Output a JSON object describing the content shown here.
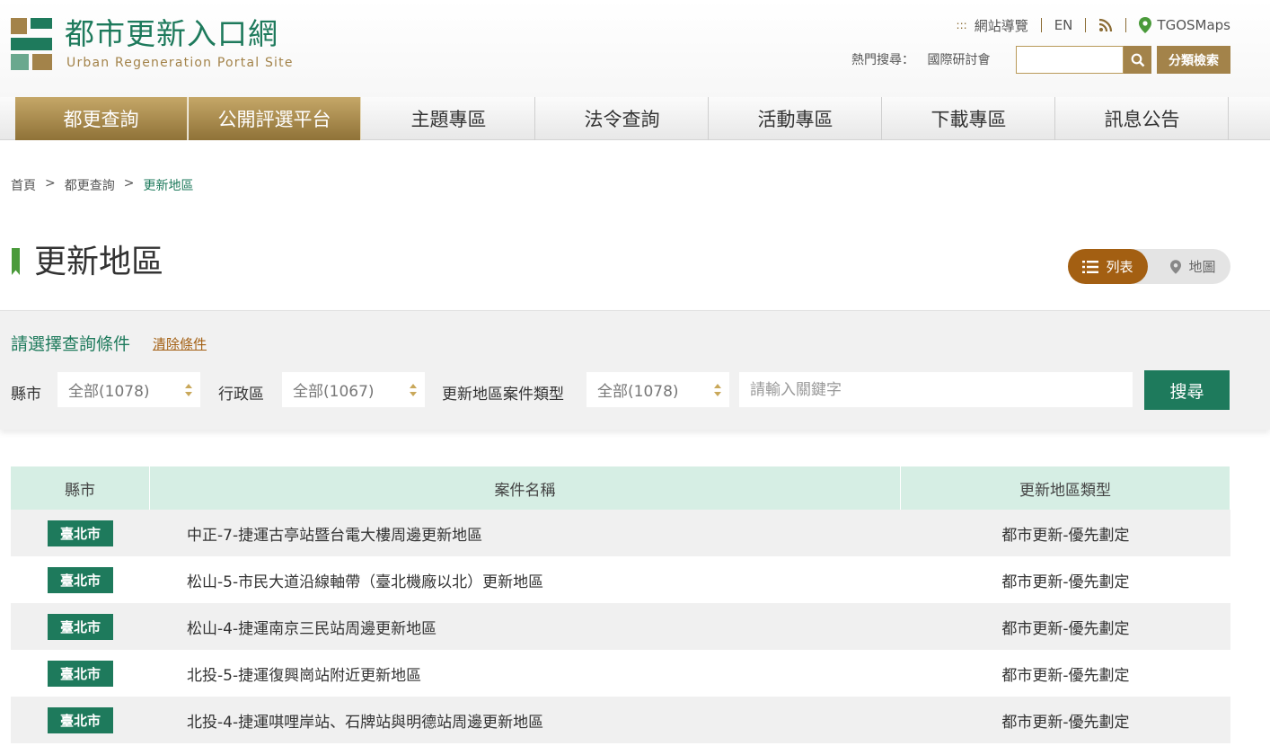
{
  "header": {
    "site_title": "都市更新入口網",
    "site_subtitle": "Urban Regeneration Portal Site",
    "top_links": {
      "sitemap": "網站導覽",
      "lang": "EN",
      "tgos": "TGOSMaps"
    },
    "hot_search_label": "熱門搜尋：",
    "hot_search_keyword": "國際研討會",
    "search_placeholder": "",
    "category_search": "分類檢索"
  },
  "nav": [
    {
      "label": "都更查詢"
    },
    {
      "label": "公開評選平台"
    },
    {
      "label": "主題專區"
    },
    {
      "label": "法令查詢"
    },
    {
      "label": "活動專區"
    },
    {
      "label": "下載專區"
    },
    {
      "label": "訊息公告"
    }
  ],
  "breadcrumb": {
    "home": "首頁",
    "level1": "都更查詢",
    "current": "更新地區",
    "sep": ">"
  },
  "page": {
    "title": "更新地區"
  },
  "view_toggle": {
    "list": "列表",
    "map": "地圖"
  },
  "filter": {
    "title": "請選擇查詢條件",
    "clear": "清除條件",
    "county_label": "縣市",
    "county_value": "全部(1078)",
    "district_label": "行政區",
    "district_value": "全部(1067)",
    "type_label": "更新地區案件類型",
    "type_value": "全部(1078)",
    "keyword_placeholder": "請輸入關鍵字",
    "search_button": "搜尋"
  },
  "table": {
    "headers": [
      "縣市",
      "案件名稱",
      "更新地區類型"
    ],
    "rows": [
      {
        "city": "臺北市",
        "name": "中正-7-捷運古亭站暨台電大樓周邊更新地區",
        "type": "都市更新-優先劃定"
      },
      {
        "city": "臺北市",
        "name": "松山-5-市民大道沿線軸帶（臺北機廠以北）更新地區",
        "type": "都市更新-優先劃定"
      },
      {
        "city": "臺北市",
        "name": "松山-4-捷運南京三民站周邊更新地區",
        "type": "都市更新-優先劃定"
      },
      {
        "city": "臺北市",
        "name": "北投-5-捷運復興崗站附近更新地區",
        "type": "都市更新-優先劃定"
      },
      {
        "city": "臺北市",
        "name": "北投-4-捷運唭哩岸站、石牌站與明德站周邊更新地區",
        "type": "都市更新-優先劃定"
      }
    ]
  },
  "colors": {
    "green": "#1e7a5c",
    "gold": "#a3834a",
    "brown": "#a35f12",
    "table_head": "#d6eee4"
  }
}
